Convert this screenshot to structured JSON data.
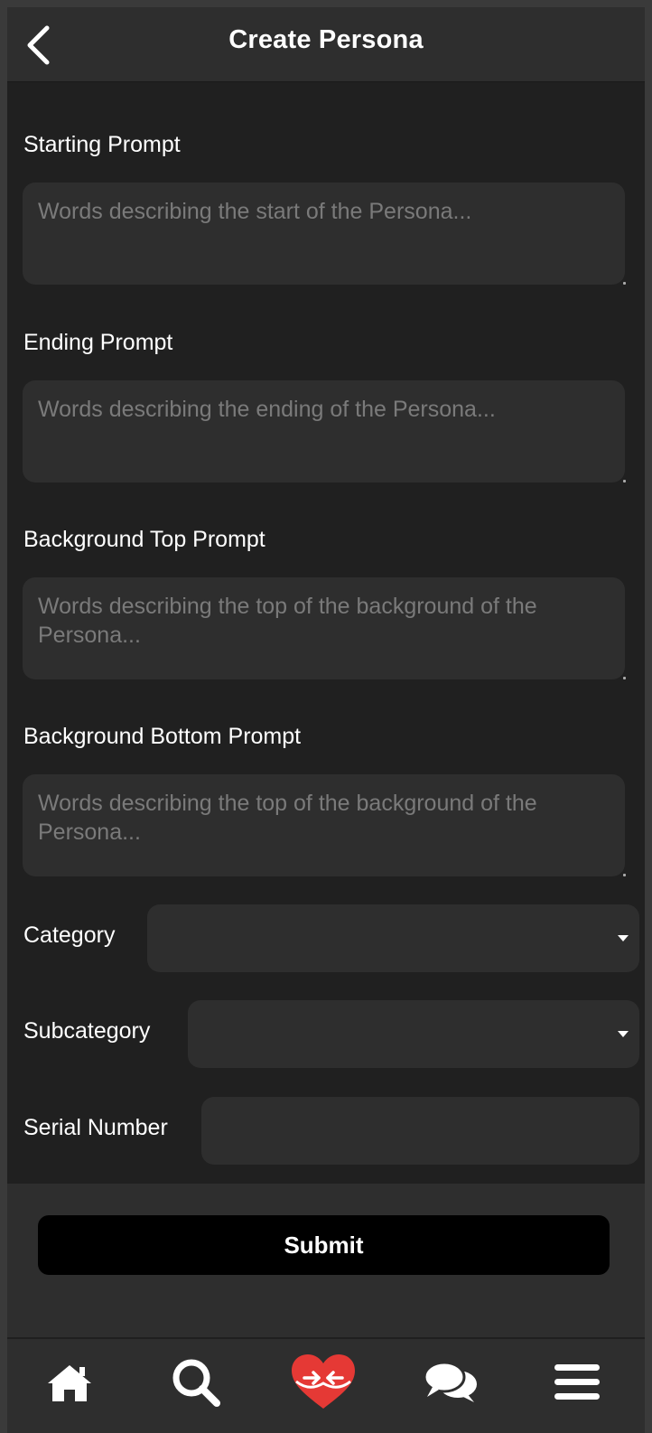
{
  "header": {
    "title": "Create Persona",
    "back_icon": "chevron-left-icon"
  },
  "form": {
    "starting_prompt": {
      "label": "Starting Prompt",
      "placeholder": "Words describing the start of the Persona...",
      "value": ""
    },
    "ending_prompt": {
      "label": "Ending Prompt",
      "placeholder": "Words describing the ending of the Persona...",
      "value": ""
    },
    "background_top_prompt": {
      "label": "Background Top Prompt",
      "placeholder": "Words describing the top of the background of the Persona...",
      "value": ""
    },
    "background_bottom_prompt": {
      "label": "Background Bottom Prompt",
      "placeholder": "Words describing the top of the background of the Persona...",
      "value": ""
    },
    "category": {
      "label": "Category",
      "value": ""
    },
    "subcategory": {
      "label": "Subcategory",
      "value": ""
    },
    "serial_number": {
      "label": "Serial Number",
      "value": ""
    }
  },
  "submit": {
    "label": "Submit"
  },
  "bottom_nav": {
    "items": [
      {
        "icon": "home-icon"
      },
      {
        "icon": "search-icon"
      },
      {
        "icon": "heart-match-icon",
        "color": "#e53935"
      },
      {
        "icon": "chat-bubbles-icon"
      },
      {
        "icon": "menu-icon"
      }
    ]
  },
  "colors": {
    "background": "#202020",
    "surface": "#2e2e2e",
    "accent": "#e53935",
    "placeholder": "#7a7a7a"
  }
}
